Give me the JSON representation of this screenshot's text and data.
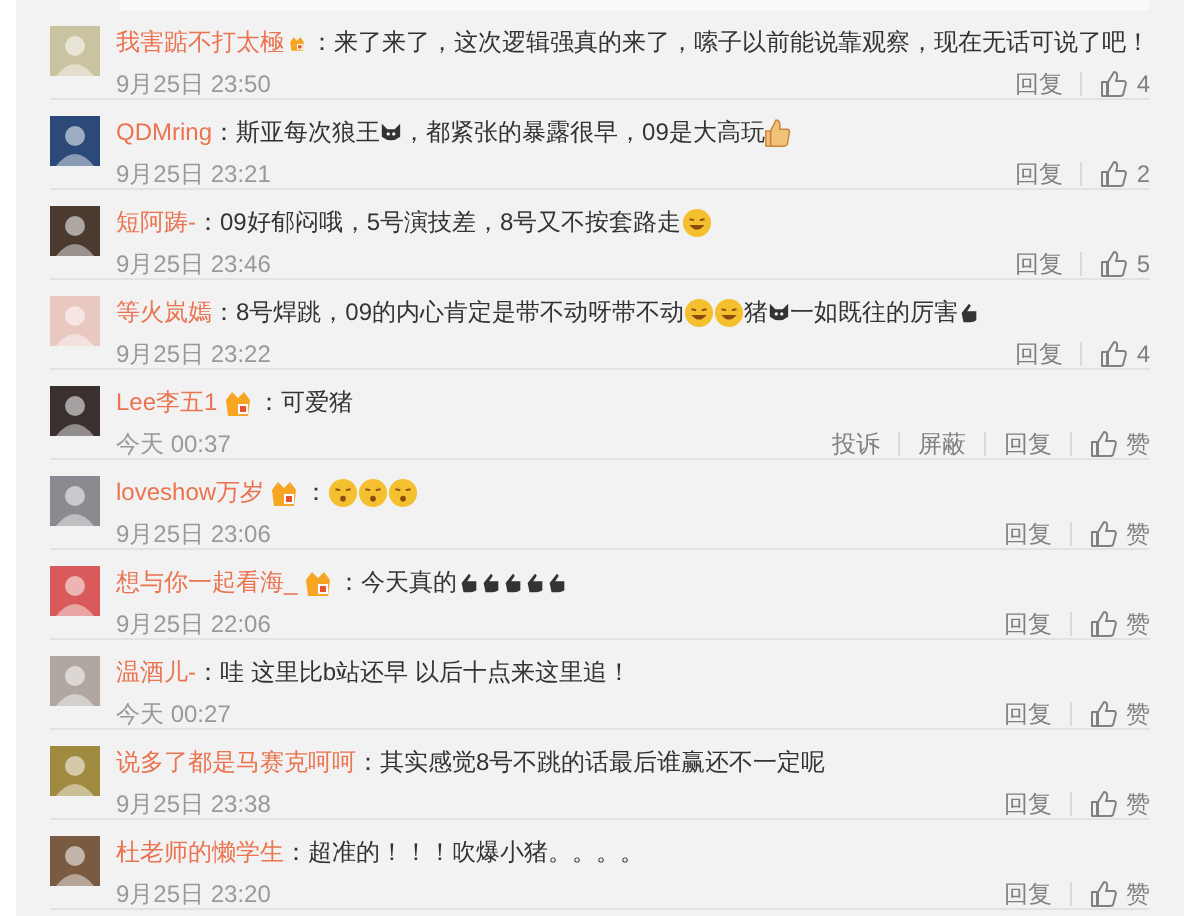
{
  "comments": [
    {
      "user": "我害踮不打太極",
      "vip": true,
      "parts": [
        {
          "kind": "text",
          "text": "：来了来了，这次逻辑强真的来了，嗦子以前能说靠观察，现在无话可说了吧！"
        }
      ],
      "time": "9月25日 23:50",
      "actions": [
        "回复"
      ],
      "likes": "4"
    },
    {
      "user": "QDMring",
      "vip": false,
      "parts": [
        {
          "kind": "text",
          "text": "：斯亚每次狼王"
        },
        {
          "kind": "wolf"
        },
        {
          "kind": "text",
          "text": "，都紧张的暴露很早，09是大高玩"
        },
        {
          "kind": "thumb"
        }
      ],
      "time": "9月25日 23:21",
      "actions": [
        "回复"
      ],
      "likes": "2"
    },
    {
      "user": "短阿踌-",
      "vip": false,
      "parts": [
        {
          "kind": "text",
          "text": "：09好郁闷哦，5号演技差，8号又不按套路走"
        },
        {
          "kind": "laugh"
        }
      ],
      "time": "9月25日 23:46",
      "actions": [
        "回复"
      ],
      "likes": "5"
    },
    {
      "user": "等火岚嫣",
      "vip": false,
      "parts": [
        {
          "kind": "text",
          "text": "：8号焊跳，09的内心肯定是带不动呀带不动"
        },
        {
          "kind": "laugh"
        },
        {
          "kind": "laugh"
        },
        {
          "kind": "text",
          "text": "猪"
        },
        {
          "kind": "pig"
        },
        {
          "kind": "text",
          "text": " 一如既往的厉害"
        },
        {
          "kind": "clap"
        }
      ],
      "time": "9月25日 23:22",
      "actions": [
        "回复"
      ],
      "likes": "4"
    },
    {
      "user": "Lee李五1",
      "vip": true,
      "parts": [
        {
          "kind": "text",
          "text": "：可爱猪"
        }
      ],
      "time": "今天 00:37",
      "actions": [
        "投诉",
        "屏蔽",
        "回复"
      ],
      "likes": "赞"
    },
    {
      "user": "loveshow万岁",
      "vip": true,
      "parts": [
        {
          "kind": "text",
          "text": "："
        },
        {
          "kind": "kiss"
        },
        {
          "kind": "kiss"
        },
        {
          "kind": "kiss"
        }
      ],
      "time": "9月25日 23:06",
      "actions": [
        "回复"
      ],
      "likes": "赞"
    },
    {
      "user": "想与你一起看海_",
      "vip": true,
      "parts": [
        {
          "kind": "text",
          "text": "：今天真的"
        },
        {
          "kind": "clap"
        },
        {
          "kind": "clap"
        },
        {
          "kind": "clap"
        },
        {
          "kind": "clap"
        },
        {
          "kind": "clap"
        }
      ],
      "time": "9月25日 22:06",
      "actions": [
        "回复"
      ],
      "likes": "赞"
    },
    {
      "user": "温酒儿-",
      "vip": false,
      "parts": [
        {
          "kind": "text",
          "text": "：哇 这里比b站还早 以后十点来这里追！"
        }
      ],
      "time": "今天 00:27",
      "actions": [
        "回复"
      ],
      "likes": "赞"
    },
    {
      "user": "说多了都是马赛克呵呵",
      "vip": false,
      "parts": [
        {
          "kind": "text",
          "text": "：其实感觉8号不跳的话最后谁赢还不一定呢"
        }
      ],
      "time": "9月25日 23:38",
      "actions": [
        "回复"
      ],
      "likes": "赞"
    },
    {
      "user": "杜老师的懒学生",
      "vip": false,
      "parts": [
        {
          "kind": "text",
          "text": "：超准的！！！吹爆小猪。。。。"
        }
      ],
      "time": "9月25日 23:20",
      "actions": [
        "回复"
      ],
      "likes": "赞"
    }
  ]
}
